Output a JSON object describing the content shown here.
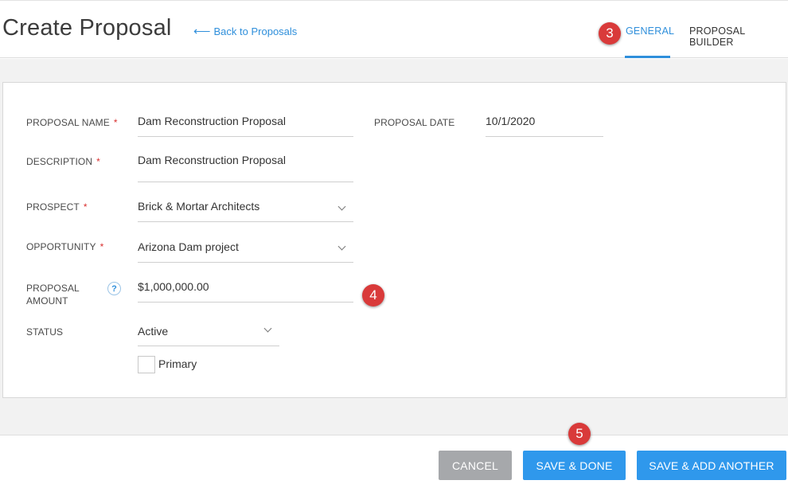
{
  "header": {
    "title": "Create Proposal",
    "back_arrow": "⟵",
    "back_label": "Back to Proposals",
    "tabs": [
      {
        "label": "GENERAL",
        "active": true
      },
      {
        "label": "PROPOSAL BUILDER",
        "active": false
      }
    ]
  },
  "badges": [
    "3",
    "4",
    "5"
  ],
  "form": {
    "required_mark": "*",
    "proposal_name": {
      "label": "PROPOSAL NAME",
      "value": "Dam Reconstruction Proposal"
    },
    "proposal_date": {
      "label": "PROPOSAL DATE",
      "value": "10/1/2020"
    },
    "description": {
      "label": "DESCRIPTION",
      "value": "Dam Reconstruction Proposal"
    },
    "prospect": {
      "label": "PROSPECT",
      "value": "Brick & Mortar Architects"
    },
    "opportunity": {
      "label": "OPPORTUNITY",
      "value": "Arizona Dam project"
    },
    "proposal_amount": {
      "label_line1": "PROPOSAL",
      "label_line2": "AMOUNT",
      "value": "$1,000,000.00",
      "help": "?"
    },
    "status": {
      "label": "STATUS",
      "value": "Active"
    },
    "primary": {
      "label": "Primary",
      "checked": false
    }
  },
  "footer": {
    "cancel_label": "CANCEL",
    "save_done_label": "SAVE & DONE",
    "save_another_label": "SAVE & ADD ANOTHER"
  },
  "colors": {
    "accent": "#2f98ec",
    "link": "#2f8fdb",
    "required": "#d9302f",
    "badge": "#d93a3a",
    "cancel": "#a6a8ab"
  }
}
